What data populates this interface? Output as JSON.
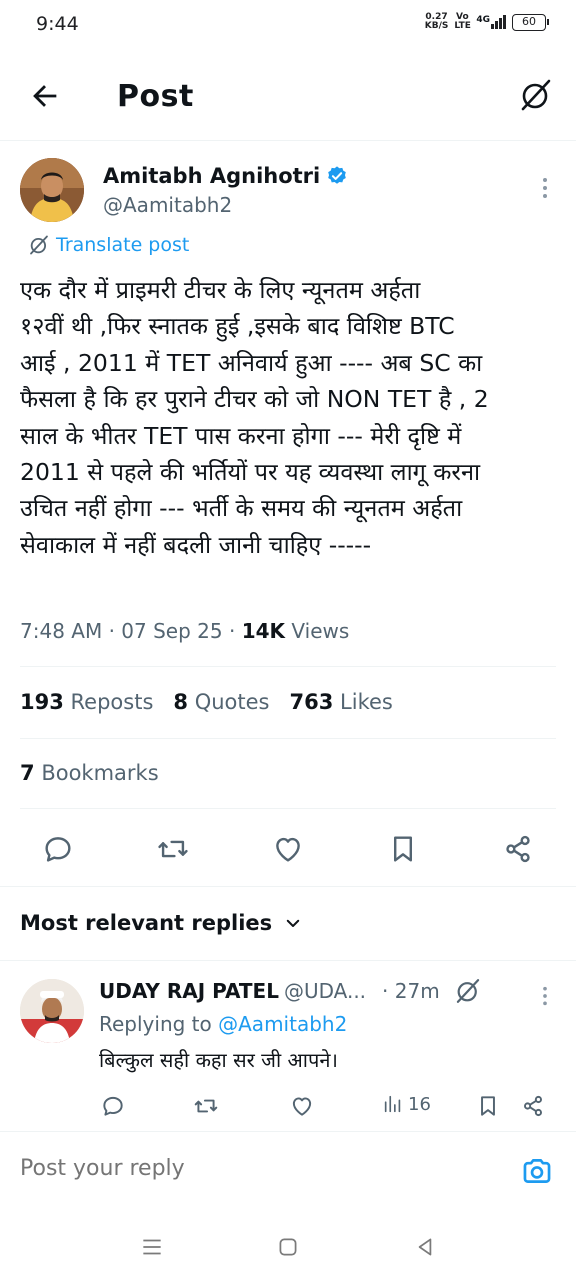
{
  "status_bar": {
    "time": "9:44",
    "net_speed_value": "0.27",
    "net_speed_unit": "KB/S",
    "volte": "Vo LTE",
    "signal": "4G",
    "battery": "60"
  },
  "header": {
    "title": "Post",
    "back_icon": "arrow-left-icon",
    "grok_icon": "grok-icon"
  },
  "tweet": {
    "author_name": "Amitabh Agnihotri",
    "author_handle": "@Aamitabh2",
    "verified": true,
    "translate_label": "Translate post",
    "text": "एक दौर में प्राइमरी टीचर के लिए न्यूनतम अर्हता\n१२वीं थी ,फिर स्नातक हुई ,इसके बाद विशिष्ट BTC\nआई , 2011 में TET अनिवार्य हुआ ---- अब SC का\nफैसला है कि हर पुराने टीचर को जो NON TET है , 2\nसाल के भीतर TET पास करना होगा --- मेरी दृष्टि में\n2011 से पहले की भर्तियों पर यह व्यवस्था लागू करना\nउचित नहीं होगा --- भर्ती के समय की न्यूनतम अर्हता\nसेवाकाल में नहीं बदली जानी चाहिए -----",
    "time": "7:48 AM",
    "date": "07 Sep 25",
    "views_count": "14K",
    "views_label": "Views",
    "reposts_count": "193",
    "reposts_label": "Reposts",
    "quotes_count": "8",
    "quotes_label": "Quotes",
    "likes_count": "763",
    "likes_label": "Likes",
    "bookmarks_count": "7",
    "bookmarks_label": "Bookmarks"
  },
  "actions": [
    "reply-icon",
    "repost-icon",
    "like-icon",
    "bookmark-icon",
    "share-icon"
  ],
  "replies_section": {
    "sort_label": "Most relevant replies"
  },
  "reply": {
    "name": "UDAY RAJ PATEL",
    "handle": "@UDA...",
    "time": "· 27m",
    "replying_to_prefix": "Replying to",
    "replying_to_handle": "@Aamitabh2",
    "text": "बिल्कुल सही कहा सर जी आपने।",
    "views": "16"
  },
  "reply_bar": {
    "placeholder": "Post your reply"
  },
  "colors": {
    "accent": "#1d9bf0",
    "text_primary": "#0f1419",
    "text_secondary": "#536471",
    "divider": "#eff3f4"
  }
}
